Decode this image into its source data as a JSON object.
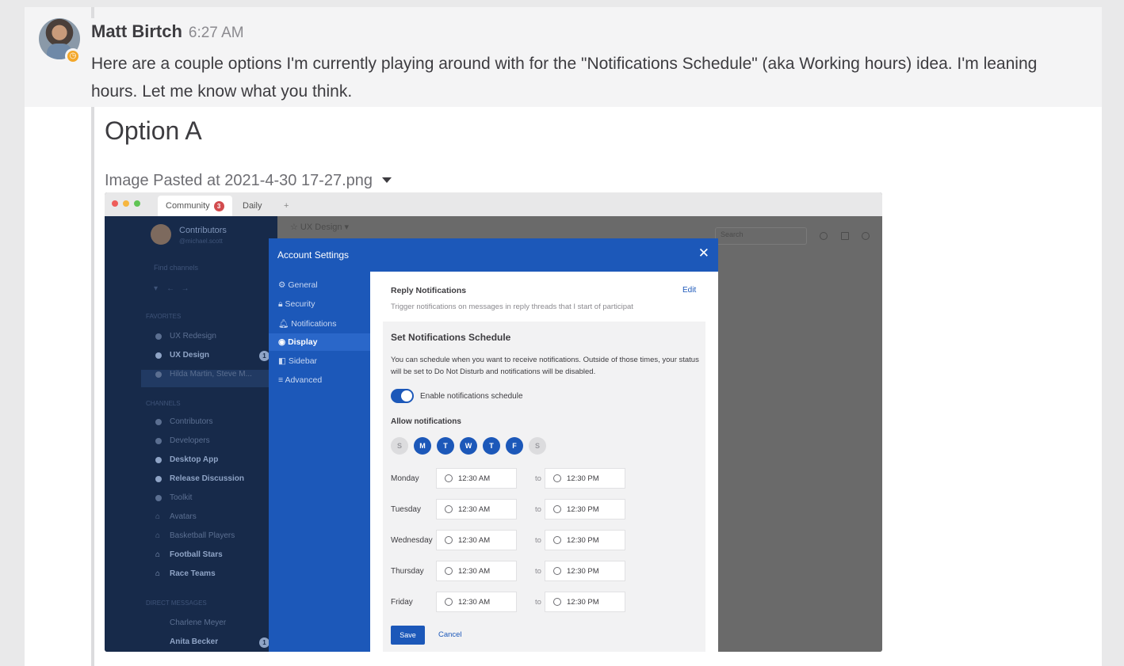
{
  "post": {
    "author": "Matt Birtch",
    "time": "6:27 AM",
    "status_icon": "clock-icon",
    "message_line1": "Here are a couple options I'm currently playing around with for the \"Notifications Schedule\" (aka Working hours) idea. I'm leaning",
    "message_line2": "hours. Let me know what you think.",
    "heading": "Option A",
    "attachment_name": "Image Pasted at 2021-4-30 17-27.png"
  },
  "screenshot": {
    "browser": {
      "tab_active": "Community",
      "tab_badge": "3",
      "tab_other": "Daily",
      "new_tab": "+"
    },
    "sidebar": {
      "team": "Contributors",
      "team_handle": "@michael.scott",
      "find": "Find channels",
      "favorites_header": "FAVORITES",
      "favorites": [
        "UX Redesign",
        "UX Design",
        "Hilda Martin, Steve M..."
      ],
      "favorites_badge": "1",
      "channels_header": "CHANNELS",
      "channels": [
        "Contributors",
        "Developers",
        "Desktop App",
        "Release Discussion",
        "Toolkit",
        "Avatars",
        "Basketball Players",
        "Football Stars",
        "Race Teams"
      ],
      "dm_header": "DIRECT MESSAGES",
      "dms": [
        "Charlene Meyer",
        "Anita Becker"
      ],
      "dm_badge": "1"
    },
    "channel_header": "☆ UX Design ▾",
    "search_placeholder": "Search",
    "modal": {
      "title": "Account Settings",
      "close": "✕",
      "nav": [
        "General",
        "Security",
        "Notifications",
        "Display",
        "Sidebar",
        "Advanced"
      ],
      "reply_title": "Reply Notifications",
      "reply_edit": "Edit",
      "reply_desc": "Trigger notifications on messages in reply threads that I start of participat",
      "schedule_title": "Set Notifications Schedule",
      "schedule_desc": "You can schedule when you want to receive notifications. Outside of those times, your status will be set to Do Not Disturb and notifications will be disabled.",
      "toggle_label": "Enable notifications schedule",
      "allow_label": "Allow notifications",
      "days": [
        "S",
        "M",
        "T",
        "W",
        "T",
        "F",
        "S"
      ],
      "rows": [
        {
          "day": "Monday",
          "from": "12:30 AM",
          "to": "12:30 PM"
        },
        {
          "day": "Tuesday",
          "from": "12:30 AM",
          "to": "12:30 PM"
        },
        {
          "day": "Wednesday",
          "from": "12:30 AM",
          "to": "12:30 PM"
        },
        {
          "day": "Thursday",
          "from": "12:30 AM",
          "to": "12:30 PM"
        },
        {
          "day": "Friday",
          "from": "12:30 AM",
          "to": "12:30 PM"
        }
      ],
      "to_word": "to",
      "save": "Save",
      "cancel": "Cancel"
    }
  }
}
